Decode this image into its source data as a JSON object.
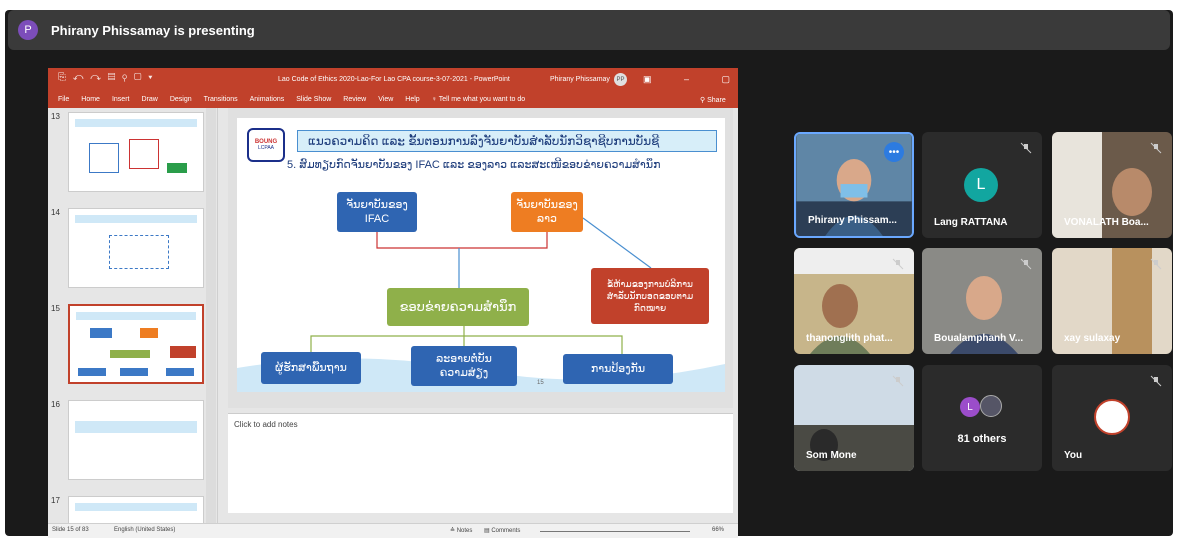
{
  "topbar": {
    "avatar_letter": "P",
    "presenting_text": "Phirany Phissamay is presenting"
  },
  "ppt": {
    "quick_access": "⎘ ↶ ↷ ▤ ⚲ ▢ ▾",
    "doc_title": "Lao Code of Ethics 2020-Lao-For Lao CPA course-3-07-2021 - PowerPoint",
    "user": "Phirany Phissamay",
    "user_initials": "PP",
    "window_controls": "▣ – ▢ ✕",
    "menu": [
      "File",
      "Home",
      "Insert",
      "Draw",
      "Design",
      "Transitions",
      "Animations",
      "Slide Show",
      "Review",
      "View",
      "Help",
      "♀ Tell me what you want to do"
    ],
    "share": "⚲ Share",
    "thumbs": [
      "13",
      "14",
      "15",
      "16",
      "17"
    ],
    "slide": {
      "logo_top": "BOUNG",
      "logo_bottom": "LCPAA",
      "title": "ແນວຄວາມຄິດ ແລະ ຂັ້ນຕອນການລົງຈັນຍາບັນສຳລັບນັກວິຊາຊີບການບັນຊີ",
      "subtitle": "5.  ສົມທຽບກົດຈັນຍາບັນຂອງ IFAC ແລະ ຂອງລາວ ແລະສະເໜີຂອບຂ່າຍຄວາມສຳນຶກ",
      "box_ifac": "ຈັນຍາບັນຂອງ\nIFAC",
      "box_lao": "ຈັນຍາບັນຂອງ\nລາວ",
      "box_network": "ຂອບຂ່າຍຄວາມສຳນຶກ",
      "box_red": "ຂໍ້ຫ້າມຂອງການບໍລິການ\nສຳລັບນັກບອດຂອບຕາມ\nກົດໝາຍ",
      "box_b1": "ຜູ້ຮັກສາພື້ນຖານ",
      "box_b2": "ລະອາຍຕໍ່ບັນ\nຄວາມສ່ຽງ",
      "box_b3": "ການປ້ອງກັນ",
      "page_num": "15"
    },
    "notes_placeholder": "Click to add notes",
    "status": {
      "slide": "Slide 15 of 83",
      "language": "English (United States)",
      "notes": "≙ Notes",
      "comments": "▤ Comments",
      "zoom": "66%"
    }
  },
  "participants": [
    {
      "name": "Phirany Phissam...",
      "type": "video",
      "active": true
    },
    {
      "name": "Lang RATTANA",
      "type": "avatar",
      "letter": "L"
    },
    {
      "name": "VONALATH Boa...",
      "type": "video"
    },
    {
      "name": "thanonglith phat...",
      "type": "video"
    },
    {
      "name": "Boualamphanh V...",
      "type": "video"
    },
    {
      "name": "xay sulaxay",
      "type": "video"
    },
    {
      "name": "Som Mone",
      "type": "video"
    },
    {
      "name": "81 others",
      "type": "group",
      "letter": "L"
    },
    {
      "name": "You",
      "type": "logo"
    }
  ],
  "colors": {
    "ribbon": "#c1412b",
    "accent": "#6aa8ff"
  }
}
